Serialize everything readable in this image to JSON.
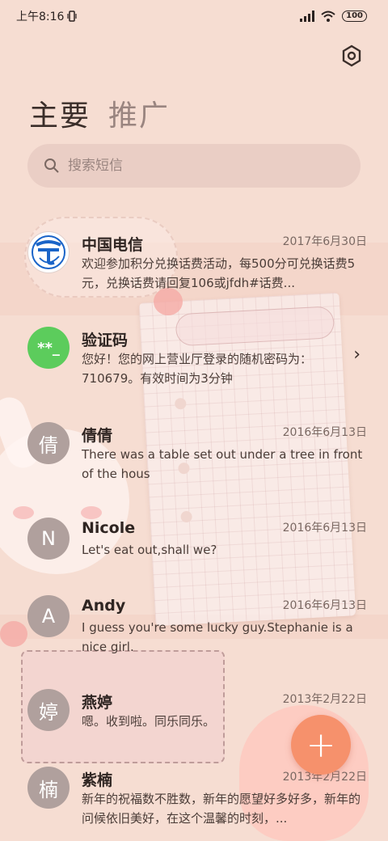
{
  "status": {
    "time": "上午8:16",
    "battery": "100"
  },
  "tabs": [
    {
      "label": "主要"
    },
    {
      "label": "推广"
    }
  ],
  "search": {
    "placeholder": "搜索短信"
  },
  "messages": [
    {
      "avatar_text": "",
      "name": "中国电信",
      "date": "2017年6月30日",
      "preview": "欢迎参加积分兑换话费活动，每500分可兑换话费5元，兑换话费请回复106或jfdh#话费..."
    },
    {
      "avatar_text": "**_",
      "name": "验证码",
      "date": "",
      "preview": "您好！您的网上营业厅登录的随机密码为：710679。有效时间为3分钟"
    },
    {
      "avatar_text": "倩",
      "name": "倩倩",
      "date": "2016年6月13日",
      "preview": "There was a table set out under a tree in front of the hous"
    },
    {
      "avatar_text": "N",
      "name": "Nicole",
      "date": "2016年6月13日",
      "preview": "Let's eat out,shall we?"
    },
    {
      "avatar_text": "A",
      "name": "Andy",
      "date": "2016年6月13日",
      "preview": "I guess you're some lucky guy.Stephanie is a nice girl."
    },
    {
      "avatar_text": "婷",
      "name": "燕婷",
      "date": "2013年2月22日",
      "preview": "嗯。收到啦。同乐同乐。"
    },
    {
      "avatar_text": "楠",
      "name": "紫楠",
      "date": "2013年2月22日",
      "preview": "新年的祝福数不胜数，新年的愿望好多好多，新年的问候依旧美好，在这个温馨的时刻，..."
    }
  ],
  "fab": {
    "label": "+"
  },
  "colors": {
    "accent": "#f6916c",
    "verify_green": "#5ccc5c",
    "telecom_blue": "#1a64c8"
  }
}
